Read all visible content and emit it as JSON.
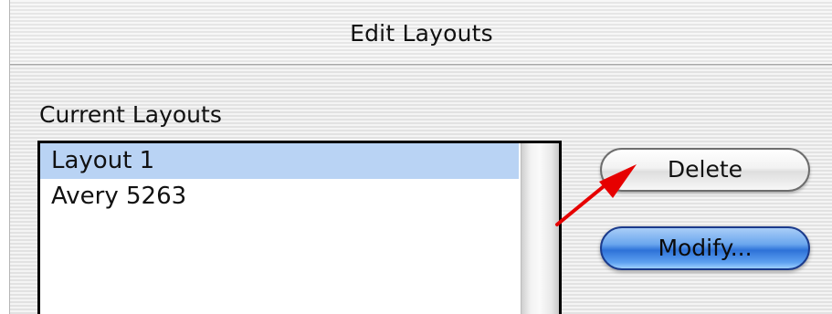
{
  "window": {
    "title": "Edit Layouts"
  },
  "layouts": {
    "label": "Current Layouts",
    "items": [
      {
        "label": "Layout 1",
        "selected": true
      },
      {
        "label": "Avery 5263",
        "selected": false
      }
    ]
  },
  "buttons": {
    "delete_label": "Delete",
    "modify_label": "Modify..."
  },
  "colors": {
    "selection": "#b9d3f4",
    "default_button": "#3f86e6",
    "annotation_arrow": "#e60000"
  }
}
